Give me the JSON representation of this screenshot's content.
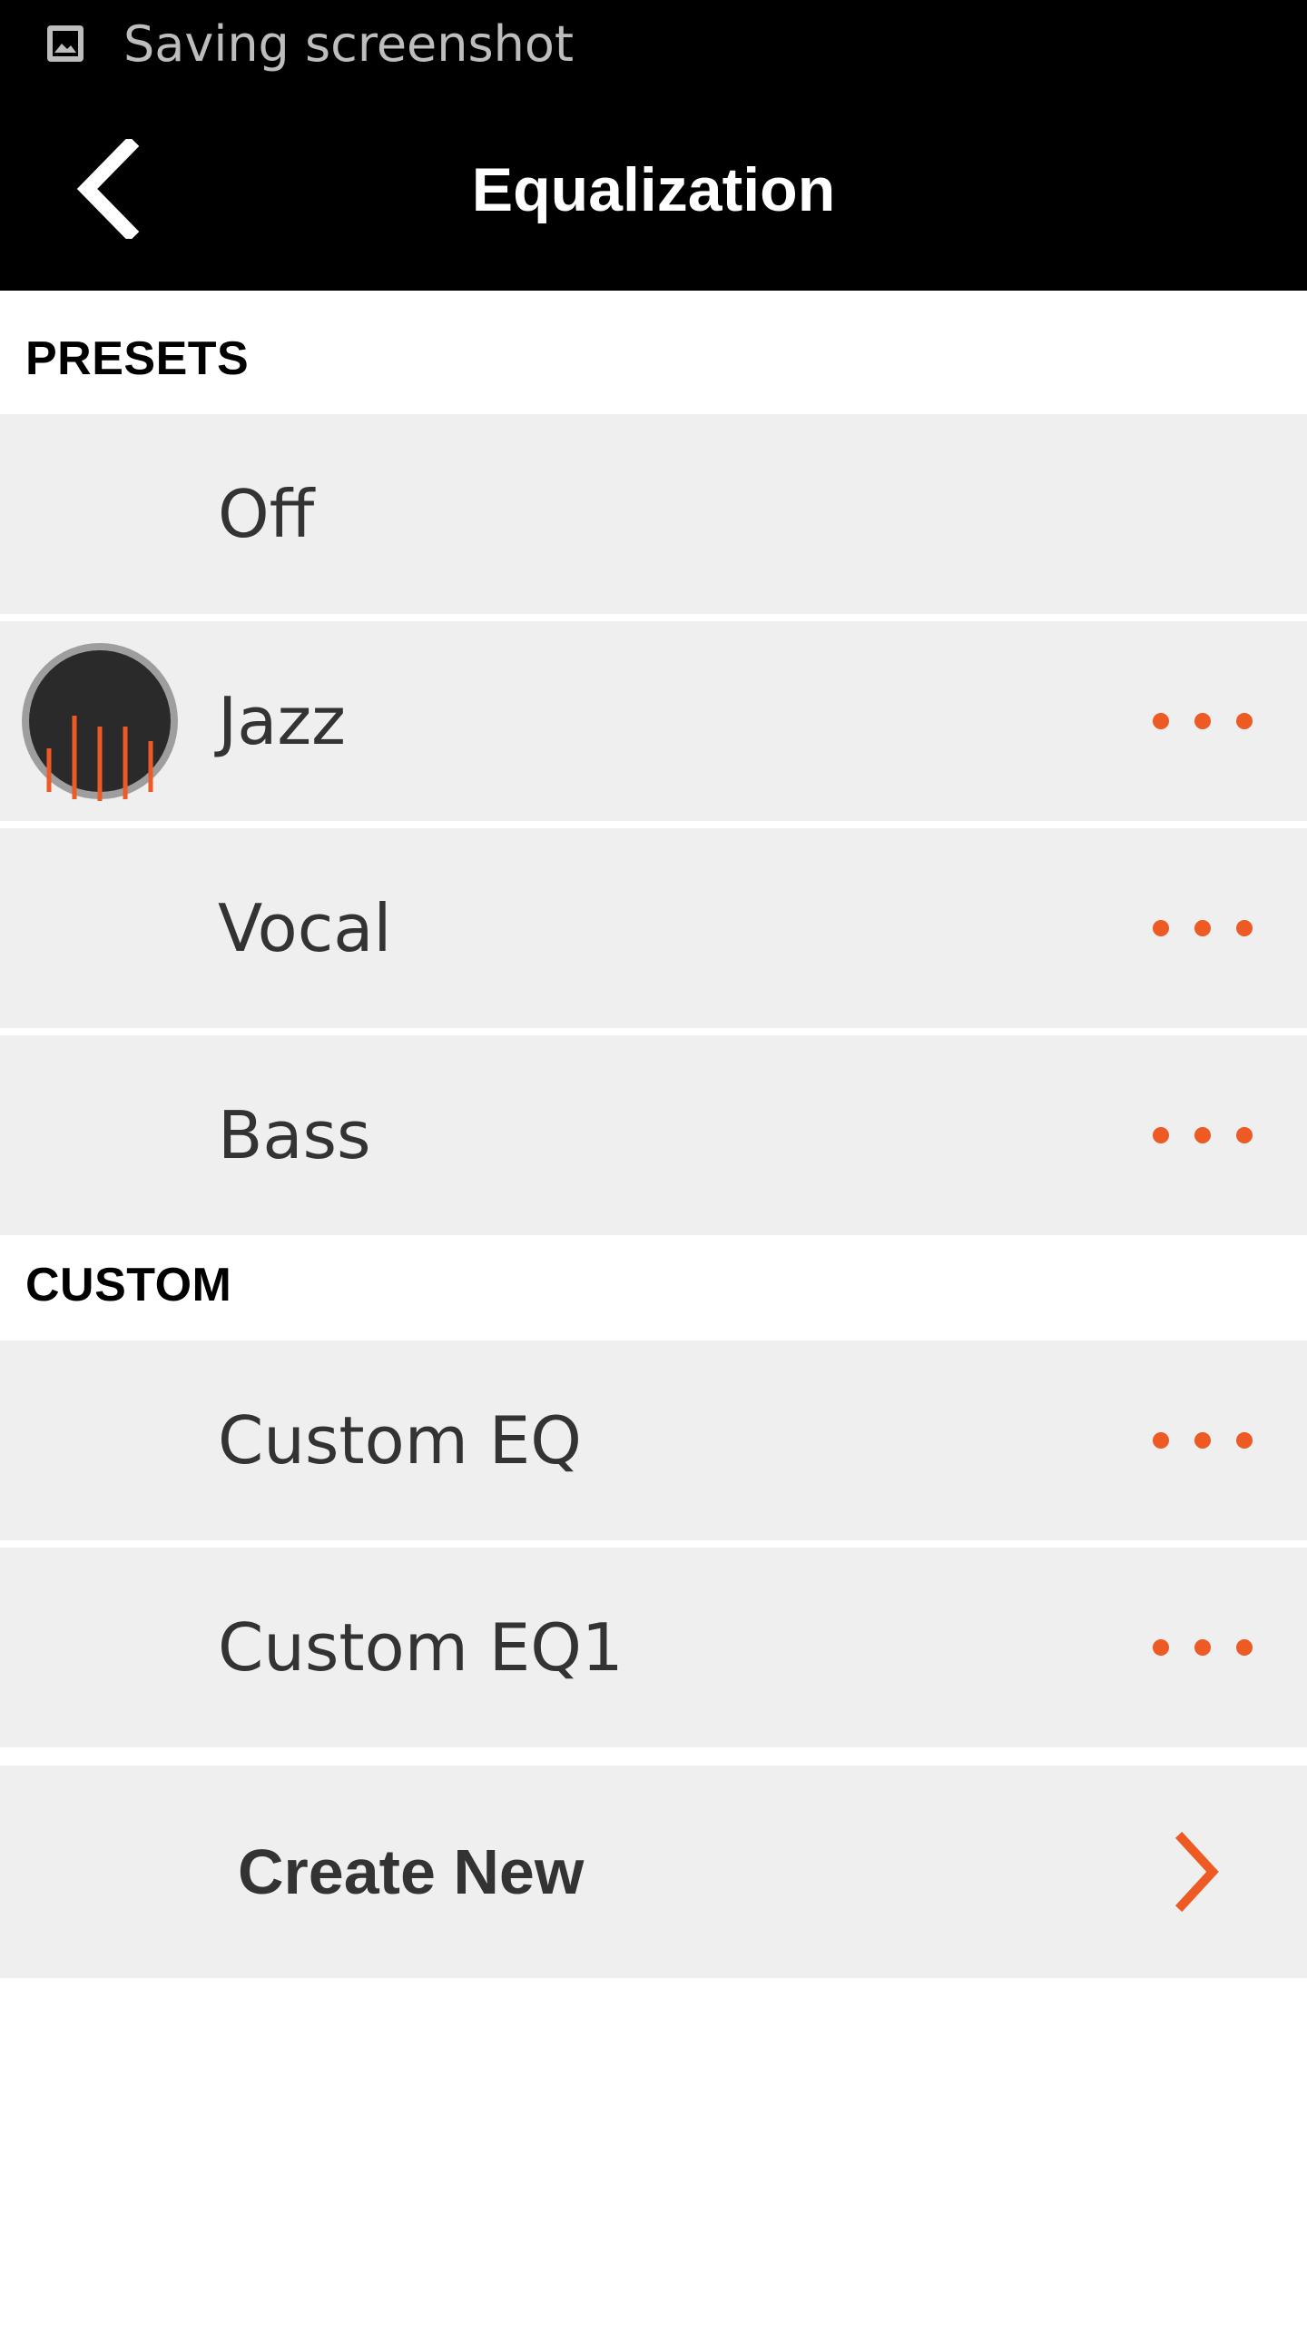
{
  "status_bar": {
    "icon": "image-icon",
    "text": "Saving screenshot"
  },
  "app_bar": {
    "back_icon": "chevron-left-icon",
    "title": "Equalization"
  },
  "sections": {
    "presets_title": "PRESETS",
    "custom_title": "CUSTOM"
  },
  "presets": [
    {
      "label": "Off",
      "active": false,
      "has_menu": false
    },
    {
      "label": "Jazz",
      "active": true,
      "has_menu": true
    },
    {
      "label": "Vocal",
      "active": false,
      "has_menu": true
    },
    {
      "label": "Bass",
      "active": false,
      "has_menu": true
    }
  ],
  "custom": [
    {
      "label": "Custom EQ",
      "has_menu": true
    },
    {
      "label": "Custom EQ1",
      "has_menu": true
    }
  ],
  "create_new": {
    "label": "Create New",
    "icon": "chevron-right-icon"
  },
  "colors": {
    "accent": "#ee5a24",
    "row_bg": "#efefef",
    "bar_bg": "#000000"
  }
}
